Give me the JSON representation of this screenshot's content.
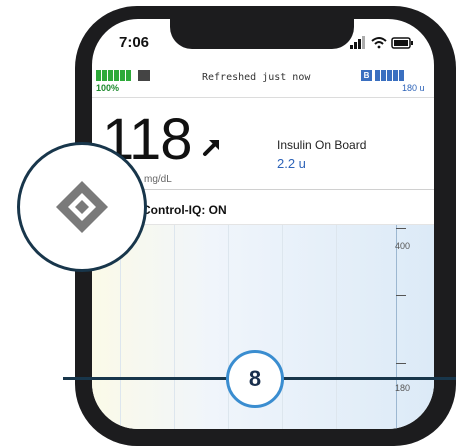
{
  "status_bar": {
    "time": "7:06"
  },
  "info_bar": {
    "pump_battery": "100%",
    "refresh_status": "Refreshed just now",
    "insulin_badge": "B",
    "insulin_remaining": "180 u"
  },
  "glucose": {
    "value": "118",
    "unit": "mg/dL",
    "trend_icon": "arrow-up-right-icon"
  },
  "iob": {
    "label": "Insulin On Board",
    "value": "2.2 u"
  },
  "control_iq": {
    "label": "Control-IQ: ON"
  },
  "graph": {
    "labels": [
      "400",
      "180"
    ]
  },
  "step": {
    "number": "8"
  },
  "colors": {
    "navy": "#18364b",
    "accent_blue": "#3a8dd0",
    "insulin_blue": "#2d63b8",
    "battery_green": "#2eaa3a"
  }
}
